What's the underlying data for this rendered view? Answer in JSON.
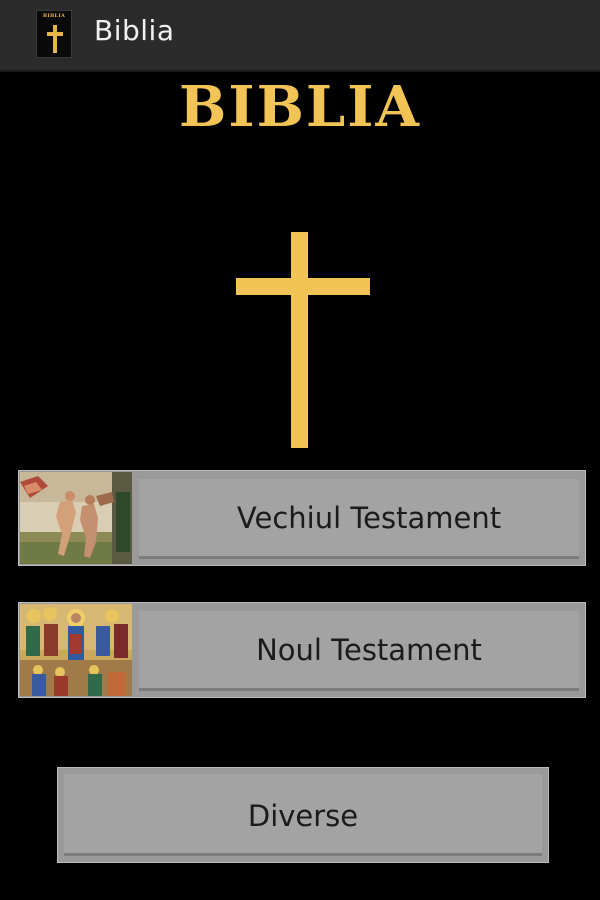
{
  "action_bar": {
    "app_icon": "bible-cross-icon",
    "app_icon_text": "BIBLIA",
    "title": "Biblia"
  },
  "header": {
    "logo_text": "BIBLIA",
    "logo_color": "#f2c455",
    "emblem": "cross-icon"
  },
  "menu": {
    "old_testament": {
      "label": "Vechiul Testament",
      "thumbnail": "adam-and-eve-fresco-image"
    },
    "new_testament": {
      "label": "Noul Testament",
      "thumbnail": "jesus-icon-painting-image"
    },
    "misc": {
      "label": "Diverse"
    }
  },
  "colors": {
    "background": "#000000",
    "action_bar": "#2b2b2b",
    "button": "#a3a3a3",
    "accent_gold": "#f2c455"
  }
}
